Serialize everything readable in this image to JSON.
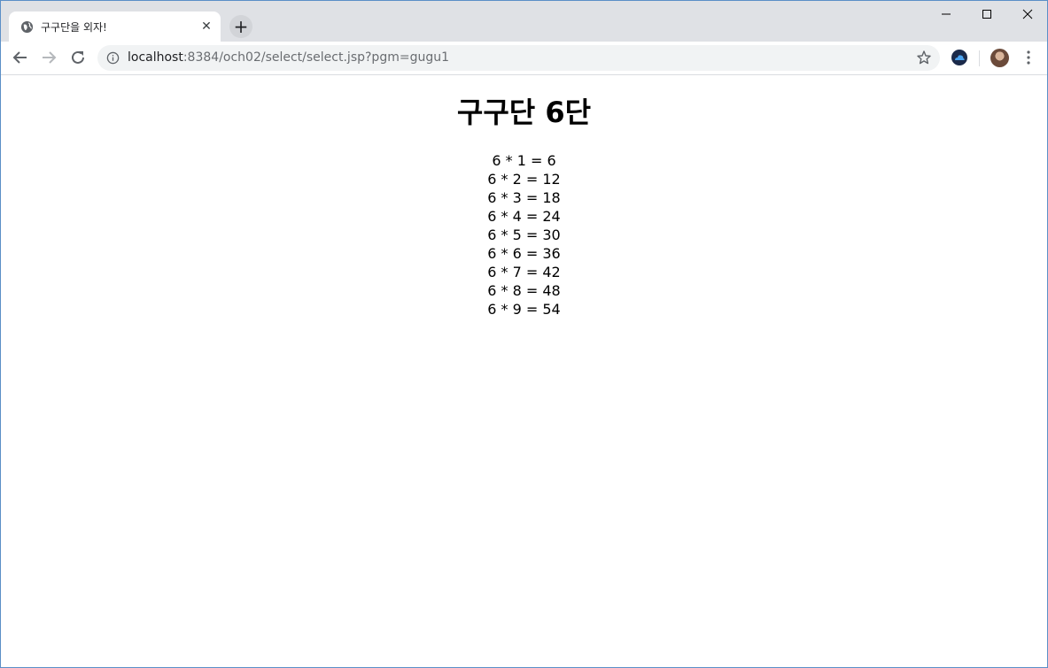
{
  "browser": {
    "tab": {
      "title": "구구단을 외자!",
      "close_label": "✕"
    },
    "new_tab_label": "+",
    "window_controls": {
      "minimize": "—",
      "maximize": "☐",
      "close": "✕"
    },
    "address_bar": {
      "host": "localhost",
      "rest": ":8384/och02/select/select.jsp?pgm=gugu1"
    },
    "icons": {
      "back": "arrow-left-icon",
      "forward": "arrow-right-icon",
      "reload": "reload-icon",
      "info": "info-icon",
      "bookmark": "star-icon",
      "extension": "cloud-extension-icon",
      "profile": "avatar",
      "menu": "kebab-menu-icon"
    }
  },
  "page": {
    "title": "구구단 6단",
    "lines": [
      "6 * 1 = 6",
      "6 * 2 = 12",
      "6 * 3 = 18",
      "6 * 4 = 24",
      "6 * 5 = 30",
      "6 * 6 = 36",
      "6 * 7 = 42",
      "6 * 8 = 48",
      "6 * 9 = 54"
    ]
  },
  "colors": {
    "tabstrip_bg": "#dfe1e5",
    "omnibox_bg": "#f1f3f4",
    "window_border": "#5b8fc7",
    "extension_icon": "#1a73e8"
  }
}
